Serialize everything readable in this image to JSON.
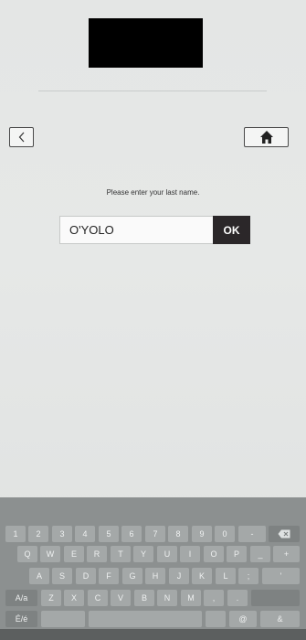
{
  "header": {},
  "nav": {},
  "form": {
    "prompt": "Please enter your last name.",
    "last_name_value": "O'YOLO",
    "ok_label": "OK"
  },
  "keyboard": {
    "row1": [
      "1",
      "2",
      "3",
      "4",
      "5",
      "6",
      "7",
      "8",
      "9",
      "0",
      "-"
    ],
    "row2": [
      "Q",
      "W",
      "E",
      "R",
      "T",
      "Y",
      "U",
      "I",
      "O",
      "P",
      "_",
      "+"
    ],
    "row3": [
      "A",
      "S",
      "D",
      "F",
      "G",
      "H",
      "J",
      "K",
      "L",
      ";",
      "'"
    ],
    "row4": [
      "Z",
      "X",
      "C",
      "V",
      "B",
      "N",
      "M",
      ",",
      "."
    ],
    "shift_label": "A/a",
    "lang_label": "É/é",
    "at_label": "@",
    "amp_label": "&"
  },
  "icons": {
    "back": "chevron-left-icon",
    "home": "home-icon",
    "backspace": "backspace-icon"
  }
}
